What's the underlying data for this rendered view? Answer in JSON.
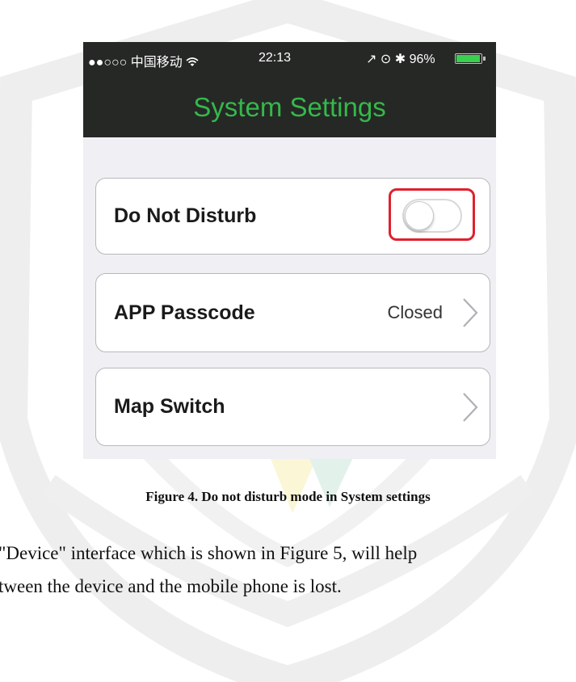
{
  "status_bar": {
    "carrier": "●●○○○ 中国移动",
    "wifi_icon": "wifi-icon",
    "time": "22:13",
    "right_icons": "↗ ⊙ ✱",
    "battery_percent": "96%",
    "battery_level": 0.96
  },
  "nav": {
    "title": "System Settings"
  },
  "settings": {
    "do_not_disturb": {
      "label": "Do Not Disturb",
      "toggle_on": false,
      "highlight_color": "#e0202e"
    },
    "app_passcode": {
      "label": "APP Passcode",
      "value": "Closed"
    },
    "map_switch": {
      "label": "Map Switch"
    }
  },
  "caption": "Figure 4. Do not disturb mode in System settings",
  "body_lines": [
    "\"Device\" interface which is shown in Figure 5, will help",
    "tween the device and the mobile phone is lost."
  ],
  "colors": {
    "nav_bg": "#262826",
    "title_green": "#35b84a",
    "battery_green": "#39d04f"
  }
}
